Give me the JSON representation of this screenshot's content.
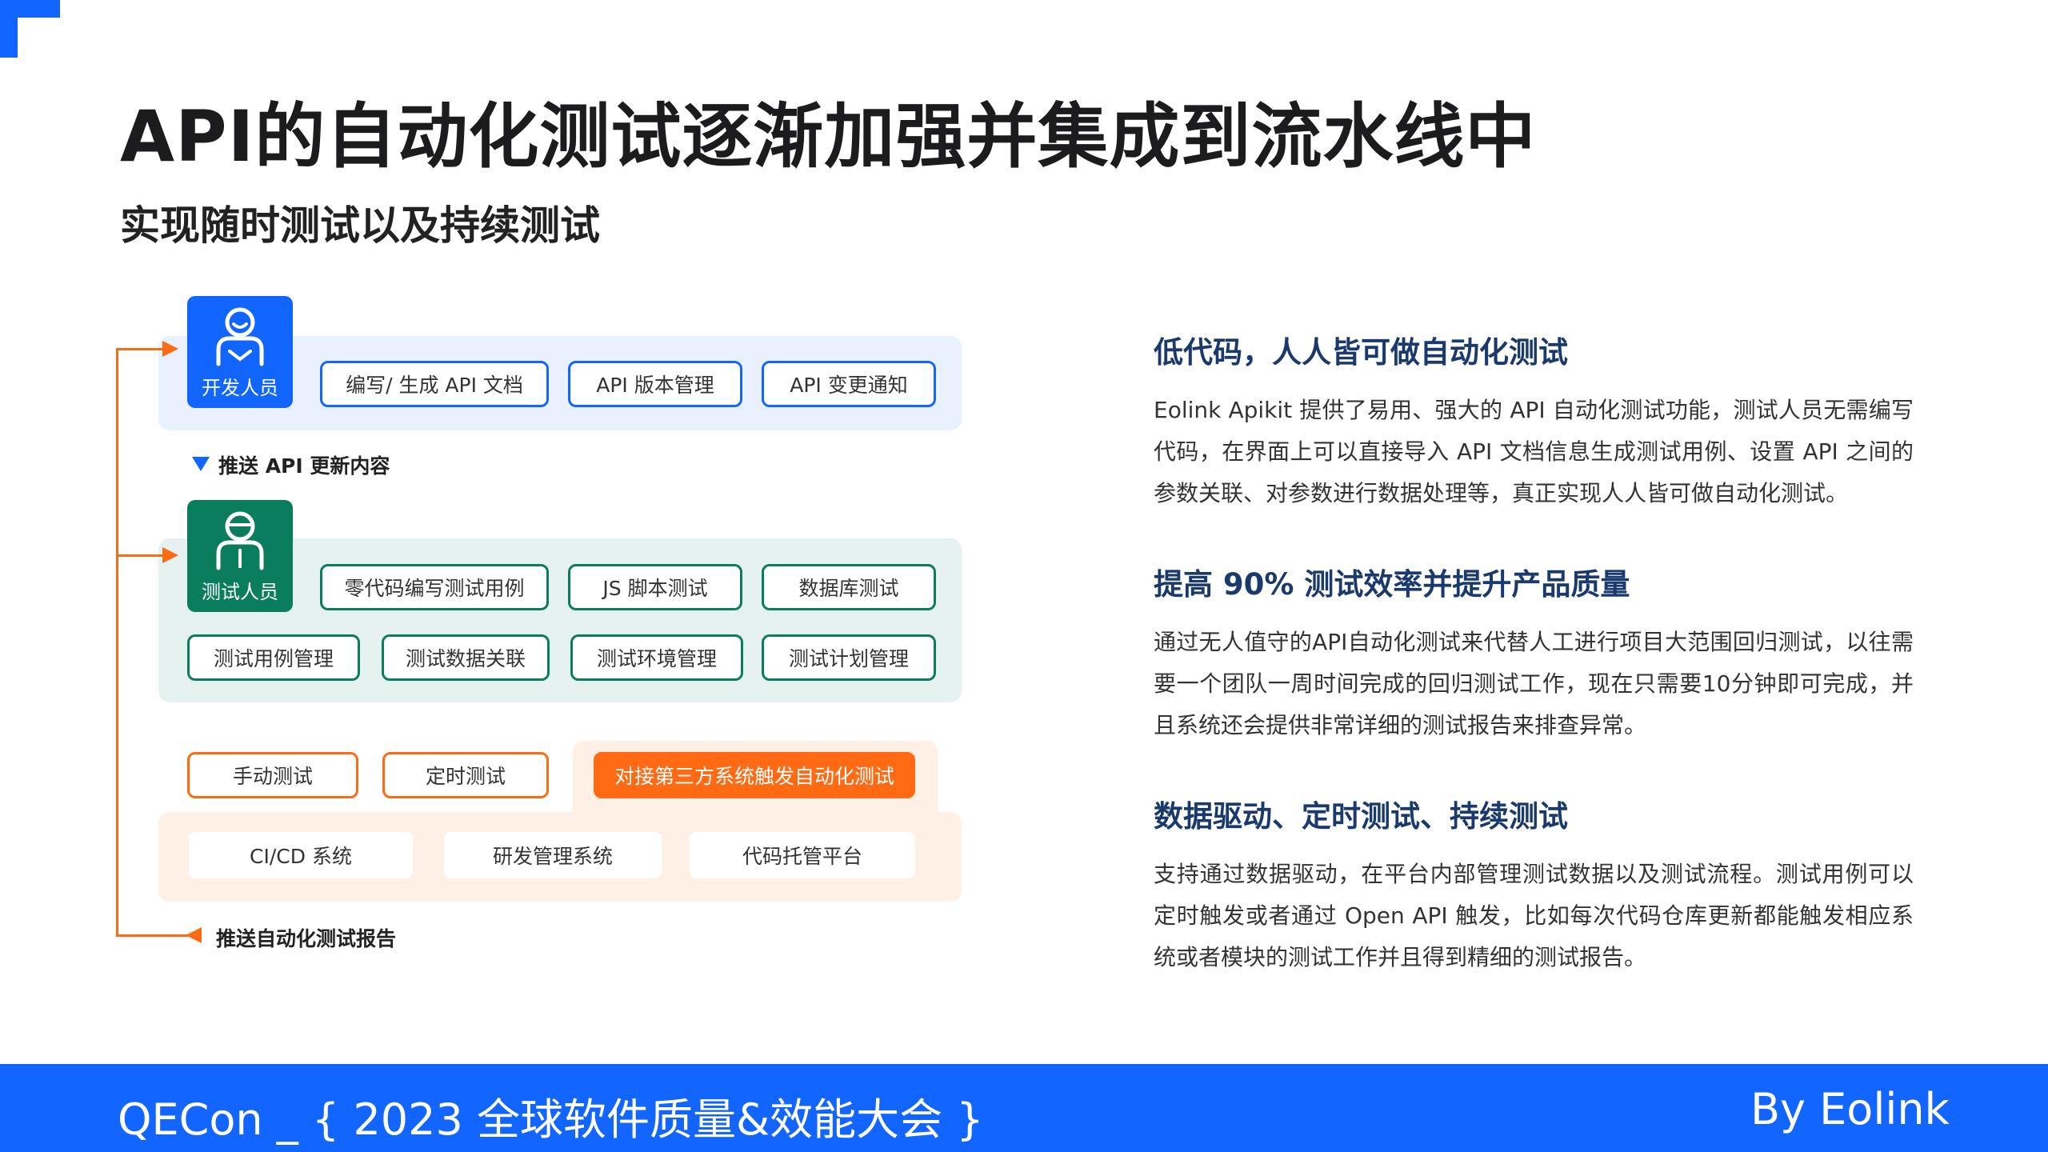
{
  "title": "API的自动化测试逐渐加强并集成到流水线中",
  "subtitle": "实现随时测试以及持续测试",
  "diagram": {
    "developer": {
      "role": "开发人员",
      "items": [
        "编写/ 生成 API 文档",
        "API 版本管理",
        "API 变更通知"
      ]
    },
    "push_update_label": "推送 API 更新内容",
    "tester": {
      "role": "测试人员",
      "items_row1": [
        "零代码编写测试用例",
        "JS 脚本测试",
        "数据库测试"
      ],
      "items_row2": [
        "测试用例管理",
        "测试数据关联",
        "测试环境管理",
        "测试计划管理"
      ]
    },
    "triggers": {
      "manual": "手动测试",
      "scheduled": "定时测试",
      "third_party": "对接第三方系统触发自动化测试"
    },
    "systems": [
      "CI/CD 系统",
      "研发管理系统",
      "代码托管平台"
    ],
    "push_report_label": "推送自动化测试报告"
  },
  "sections": [
    {
      "heading": "低代码，人人皆可做自动化测试",
      "body": "Eolink Apikit 提供了易用、强大的 API 自动化测试功能，测试人员无需编写代码，在界面上可以直接导入 API 文档信息生成测试用例、设置 API 之间的参数关联、对参数进行数据处理等，真正实现人人皆可做自动化测试。"
    },
    {
      "heading": "提高 90% 测试效率并提升产品质量",
      "body": "通过无人值守的API自动化测试来代替人工进行项目大范围回归测试，以往需要一个团队一周时间完成的回归测试工作，现在只需要10分钟即可完成，并且系统还会提供非常详细的测试报告来排查异常。"
    },
    {
      "heading": "数据驱动、定时测试、持续测试",
      "body": "支持通过数据驱动，在平台内部管理测试数据以及测试流程。测试用例可以定时触发或者通过 Open API 触发，比如每次代码仓库更新都能触发相应系统或者模块的测试工作并且得到精细的测试报告。"
    }
  ],
  "footer": {
    "left": "QECon _ { 2023 全球软件质量&效能大会 }",
    "right": "By Eolink"
  },
  "colors": {
    "brand_blue": "#1266ff",
    "tester_green": "#0b7d5f",
    "accent_orange": "#ff6a13"
  }
}
